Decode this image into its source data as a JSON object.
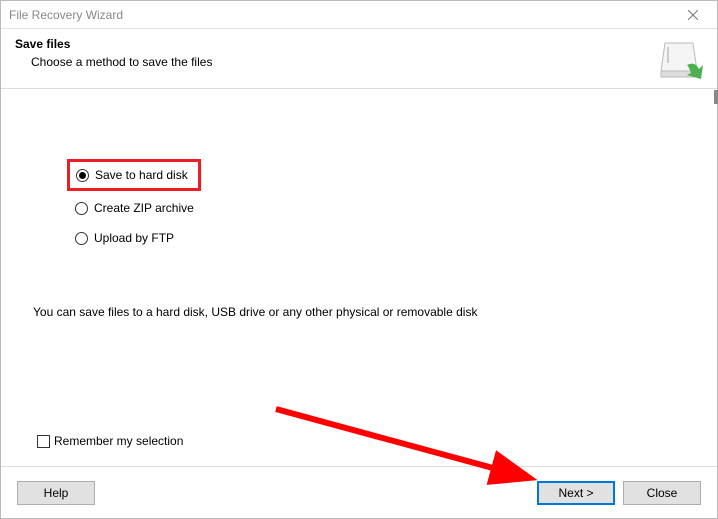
{
  "titlebar": {
    "title": "File Recovery Wizard"
  },
  "header": {
    "heading": "Save files",
    "subheading": "Choose a method to save the files"
  },
  "options": [
    {
      "label": "Save to hard disk",
      "selected": true,
      "highlighted": true
    },
    {
      "label": "Create ZIP archive",
      "selected": false,
      "highlighted": false
    },
    {
      "label": "Upload by FTP",
      "selected": false,
      "highlighted": false
    }
  ],
  "description": "You can save files to a hard disk, USB drive or any other physical or removable disk",
  "remember": {
    "label": "Remember my selection",
    "checked": false
  },
  "footer": {
    "help": "Help",
    "next": "Next >",
    "close": "Close"
  }
}
